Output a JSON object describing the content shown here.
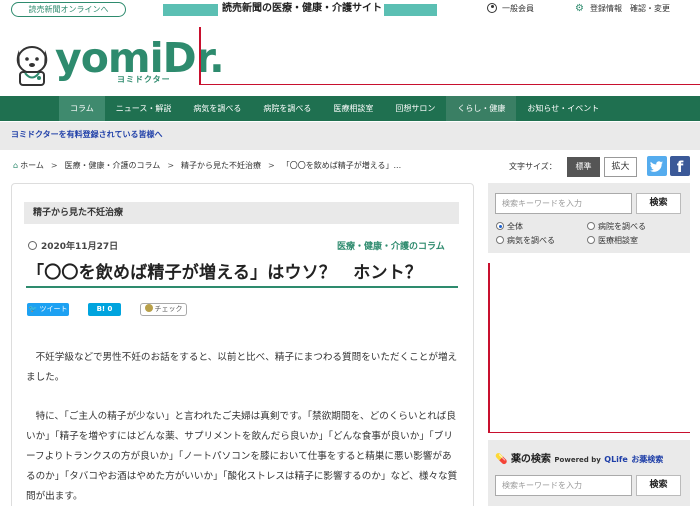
{
  "header": {
    "site_link": "読売新聞オンラインへ",
    "tagline": "読売新聞の医療・健康・介護サイト",
    "member": "一般会員",
    "account": "登録情報　確認・変更",
    "logo_text": "yomiDr.",
    "logo_sub": "ヨミドクター"
  },
  "nav": {
    "items": [
      "コラム",
      "ニュース・解説",
      "病気を調べる",
      "病院を調べる",
      "医療相談室",
      "回想サロン",
      "くらし・健康",
      "お知らせ・イベント"
    ],
    "active": "コラム"
  },
  "subbar": {
    "text": "ヨミドクターを有料登録されている皆様へ"
  },
  "breadcrumb": {
    "home": "ホーム",
    "items": [
      "医療・健康・介護のコラム",
      "精子から見た不妊治療",
      "「〇〇を飲めば精子が増える」..."
    ]
  },
  "font_size": {
    "label": "文字サイズ：",
    "standard": "標準",
    "large": "拡大"
  },
  "article": {
    "category": "精子から見た不妊治療",
    "date": "2020年11月27日",
    "column_link": "医療・健康・介護のコラム",
    "title": "「〇〇を飲めば精子が増える」はウソ？　ホント？",
    "share": {
      "tweet": "ツイート",
      "hatena": "B! 0",
      "check": "チェック"
    },
    "paragraphs": [
      "不妊学級などで男性不妊のお話をすると、以前と比べ、精子にまつわる質問をいただくことが増えました。",
      "特に、「ご主人の精子が少ない」と言われたご夫婦は真剣です。「禁欲期間を、どのくらいとれば良いか」「精子を増やすにはどんな薬、サプリメントを飲んだら良いか」「どんな食事が良いか」「ブリーフよりトランクスの方が良いか」「ノートパソコンを膝において仕事をすると精巣に悪い影響があるのか」「タバコやお酒はやめた方がいいか」「酸化ストレスは精子に影響するのか」など、様々な質問が出ます。"
    ]
  },
  "sidebar": {
    "search": {
      "placeholder": "検索キーワードを入力",
      "button": "検索",
      "options": [
        "全体",
        "病院を調べる",
        "病気を調べる",
        "医療相談室"
      ],
      "selected": "全体"
    },
    "drug": {
      "title": "薬の検索",
      "powered": "Powered by",
      "brand": "QLife",
      "brand_suffix": "お薬検索",
      "placeholder": "検索キーワードを入力",
      "button": "検索"
    }
  },
  "colors": {
    "brand": "#1f7050",
    "accent": "#2e8b6e",
    "ad_border": "#c8102e",
    "link_blue": "#1f3fa8"
  }
}
